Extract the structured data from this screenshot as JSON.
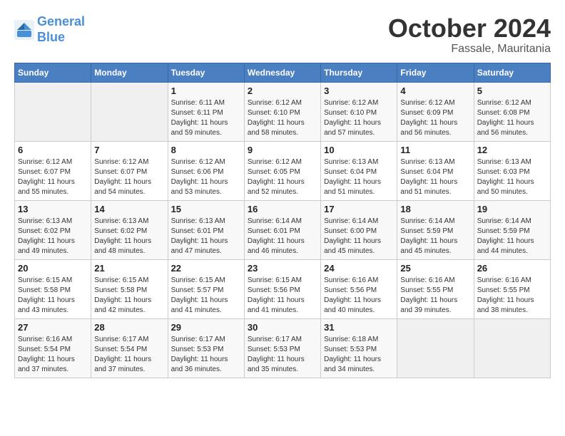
{
  "header": {
    "logo_line1": "General",
    "logo_line2": "Blue",
    "month": "October 2024",
    "location": "Fassale, Mauritania"
  },
  "weekdays": [
    "Sunday",
    "Monday",
    "Tuesday",
    "Wednesday",
    "Thursday",
    "Friday",
    "Saturday"
  ],
  "weeks": [
    [
      {
        "day": "",
        "empty": true
      },
      {
        "day": "",
        "empty": true
      },
      {
        "day": "1",
        "sunrise": "6:11 AM",
        "sunset": "6:11 PM",
        "daylight": "11 hours and 59 minutes."
      },
      {
        "day": "2",
        "sunrise": "6:12 AM",
        "sunset": "6:10 PM",
        "daylight": "11 hours and 58 minutes."
      },
      {
        "day": "3",
        "sunrise": "6:12 AM",
        "sunset": "6:10 PM",
        "daylight": "11 hours and 57 minutes."
      },
      {
        "day": "4",
        "sunrise": "6:12 AM",
        "sunset": "6:09 PM",
        "daylight": "11 hours and 56 minutes."
      },
      {
        "day": "5",
        "sunrise": "6:12 AM",
        "sunset": "6:08 PM",
        "daylight": "11 hours and 56 minutes."
      }
    ],
    [
      {
        "day": "6",
        "sunrise": "6:12 AM",
        "sunset": "6:07 PM",
        "daylight": "11 hours and 55 minutes."
      },
      {
        "day": "7",
        "sunrise": "6:12 AM",
        "sunset": "6:07 PM",
        "daylight": "11 hours and 54 minutes."
      },
      {
        "day": "8",
        "sunrise": "6:12 AM",
        "sunset": "6:06 PM",
        "daylight": "11 hours and 53 minutes."
      },
      {
        "day": "9",
        "sunrise": "6:12 AM",
        "sunset": "6:05 PM",
        "daylight": "11 hours and 52 minutes."
      },
      {
        "day": "10",
        "sunrise": "6:13 AM",
        "sunset": "6:04 PM",
        "daylight": "11 hours and 51 minutes."
      },
      {
        "day": "11",
        "sunrise": "6:13 AM",
        "sunset": "6:04 PM",
        "daylight": "11 hours and 51 minutes."
      },
      {
        "day": "12",
        "sunrise": "6:13 AM",
        "sunset": "6:03 PM",
        "daylight": "11 hours and 50 minutes."
      }
    ],
    [
      {
        "day": "13",
        "sunrise": "6:13 AM",
        "sunset": "6:02 PM",
        "daylight": "11 hours and 49 minutes."
      },
      {
        "day": "14",
        "sunrise": "6:13 AM",
        "sunset": "6:02 PM",
        "daylight": "11 hours and 48 minutes."
      },
      {
        "day": "15",
        "sunrise": "6:13 AM",
        "sunset": "6:01 PM",
        "daylight": "11 hours and 47 minutes."
      },
      {
        "day": "16",
        "sunrise": "6:14 AM",
        "sunset": "6:01 PM",
        "daylight": "11 hours and 46 minutes."
      },
      {
        "day": "17",
        "sunrise": "6:14 AM",
        "sunset": "6:00 PM",
        "daylight": "11 hours and 45 minutes."
      },
      {
        "day": "18",
        "sunrise": "6:14 AM",
        "sunset": "5:59 PM",
        "daylight": "11 hours and 45 minutes."
      },
      {
        "day": "19",
        "sunrise": "6:14 AM",
        "sunset": "5:59 PM",
        "daylight": "11 hours and 44 minutes."
      }
    ],
    [
      {
        "day": "20",
        "sunrise": "6:15 AM",
        "sunset": "5:58 PM",
        "daylight": "11 hours and 43 minutes."
      },
      {
        "day": "21",
        "sunrise": "6:15 AM",
        "sunset": "5:58 PM",
        "daylight": "11 hours and 42 minutes."
      },
      {
        "day": "22",
        "sunrise": "6:15 AM",
        "sunset": "5:57 PM",
        "daylight": "11 hours and 41 minutes."
      },
      {
        "day": "23",
        "sunrise": "6:15 AM",
        "sunset": "5:56 PM",
        "daylight": "11 hours and 41 minutes."
      },
      {
        "day": "24",
        "sunrise": "6:16 AM",
        "sunset": "5:56 PM",
        "daylight": "11 hours and 40 minutes."
      },
      {
        "day": "25",
        "sunrise": "6:16 AM",
        "sunset": "5:55 PM",
        "daylight": "11 hours and 39 minutes."
      },
      {
        "day": "26",
        "sunrise": "6:16 AM",
        "sunset": "5:55 PM",
        "daylight": "11 hours and 38 minutes."
      }
    ],
    [
      {
        "day": "27",
        "sunrise": "6:16 AM",
        "sunset": "5:54 PM",
        "daylight": "11 hours and 37 minutes."
      },
      {
        "day": "28",
        "sunrise": "6:17 AM",
        "sunset": "5:54 PM",
        "daylight": "11 hours and 37 minutes."
      },
      {
        "day": "29",
        "sunrise": "6:17 AM",
        "sunset": "5:53 PM",
        "daylight": "11 hours and 36 minutes."
      },
      {
        "day": "30",
        "sunrise": "6:17 AM",
        "sunset": "5:53 PM",
        "daylight": "11 hours and 35 minutes."
      },
      {
        "day": "31",
        "sunrise": "6:18 AM",
        "sunset": "5:53 PM",
        "daylight": "11 hours and 34 minutes."
      },
      {
        "day": "",
        "empty": true
      },
      {
        "day": "",
        "empty": true
      }
    ]
  ],
  "labels": {
    "sunrise_prefix": "Sunrise: ",
    "sunset_prefix": "Sunset: ",
    "daylight_prefix": "Daylight: "
  }
}
